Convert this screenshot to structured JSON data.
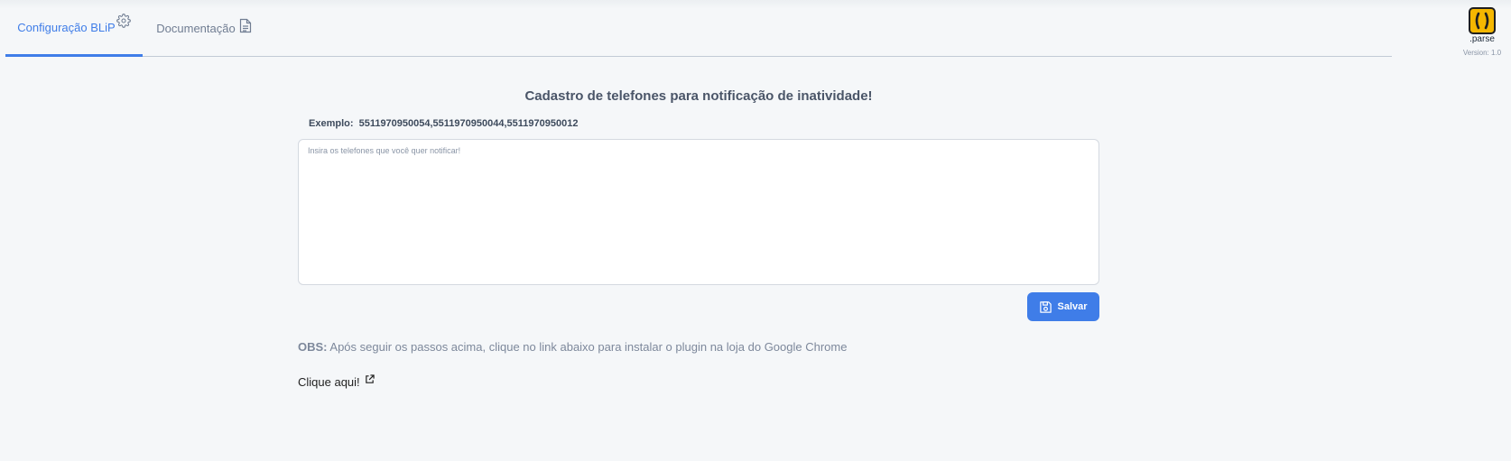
{
  "tabs": [
    {
      "label": "Configuração BLiP",
      "icon": "gear-icon",
      "active": true
    },
    {
      "label": "Documentação",
      "icon": "document-icon",
      "active": false
    }
  ],
  "brand": {
    "logo_icon": "parse-logo-icon",
    "name": ".parse",
    "version": "Version: 1.0"
  },
  "main": {
    "title": "Cadastro de telefones para notificação de inatividade!",
    "example_label": "Exemplo:",
    "example_value": "5511970950054,5511970950044,5511970950012",
    "textarea": {
      "value": "",
      "placeholder": "Insira os telefones que você quer notificar!"
    },
    "save_label": "Salvar",
    "save_icon": "floppy-disk-icon",
    "obs_label": "OBS:",
    "obs_text": "Após seguir os passos acima, clique no link abaixo para instalar o plugin na loja do Google Chrome",
    "link_label": "Clique aqui!",
    "link_icon": "external-link-icon"
  },
  "colors": {
    "accent": "#3f7de8",
    "background": "#f5f7f9",
    "logo_yellow": "#f5b700"
  }
}
